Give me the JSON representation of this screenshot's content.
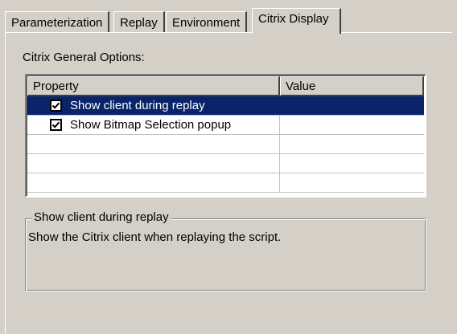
{
  "tabs": [
    {
      "label": "Parameterization",
      "active": false
    },
    {
      "label": "Replay",
      "active": false
    },
    {
      "label": "Environment",
      "active": false
    },
    {
      "label": "Citrix Display",
      "active": true
    }
  ],
  "section_title": "Citrix General Options:",
  "grid": {
    "columns": [
      "Property",
      "Value"
    ],
    "rows": [
      {
        "checked": true,
        "label": "Show client during replay",
        "value": "",
        "selected": true
      },
      {
        "checked": true,
        "label": "Show Bitmap Selection popup",
        "value": "",
        "selected": false
      }
    ]
  },
  "description": {
    "title": "Show client during replay",
    "text": "Show the Citrix client when replaying the script."
  },
  "colors": {
    "face": "#d4d0c8",
    "selection": "#0a246a"
  }
}
